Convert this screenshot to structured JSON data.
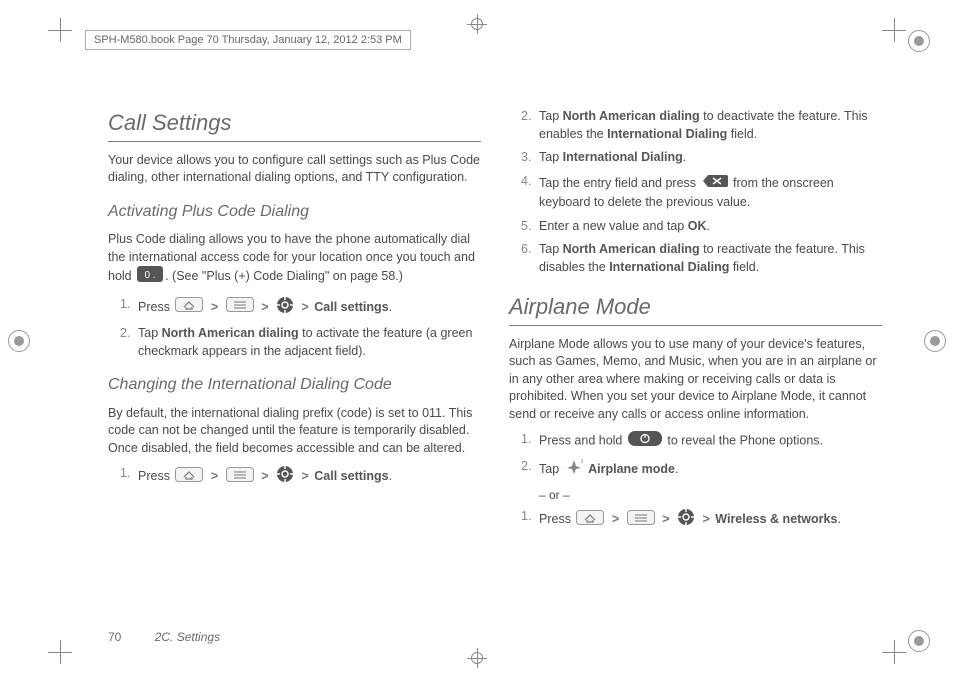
{
  "header": "SPH-M580.book  Page 70  Thursday, January 12, 2012  2:53 PM",
  "footer": {
    "page": "70",
    "section": "2C. Settings"
  },
  "left": {
    "h1": "Call Settings",
    "intro": "Your device allows you to configure call settings such as Plus Code dialing, other international dialing options, and TTY configuration.",
    "sec1": {
      "title": "Activating Plus Code Dialing",
      "body1": "Plus Code dialing allows you to have the phone automatically dial the international access code for your location once you touch and hold ",
      "body2": ". (See \"Plus (+) Code Dialing\" on page 58.)",
      "step1_a": "Press ",
      "step1_end": "Call settings",
      "step2_a": "Tap ",
      "step2_bold": "North American dialing",
      "step2_b": " to activate the feature (a green checkmark appears in the adjacent field)."
    },
    "sec2": {
      "title": "Changing the International Dialing Code",
      "body": "By default, the international dialing prefix (code) is set to 011. This code can not be changed until the feature is temporarily disabled. Once disabled, the field becomes accessible and can be altered.",
      "step1_a": "Press ",
      "step1_end": "Call settings"
    }
  },
  "right": {
    "step2_a": "Tap ",
    "step2_bold": "North American dialing",
    "step2_b": " to deactivate the feature. This enables the ",
    "step2_bold2": "International Dialing",
    "step2_c": " field.",
    "step3_a": "Tap ",
    "step3_bold": "International Dialing",
    "step4_a": "Tap the entry field and press ",
    "step4_b": " from the onscreen keyboard to delete the previous value.",
    "step5": "Enter a new value and tap ",
    "step5_bold": "OK",
    "step6_a": "Tap ",
    "step6_bold": "North American dialing",
    "step6_b": " to reactivate the feature. This disables the ",
    "step6_bold2": "International Dialing",
    "step6_c": " field.",
    "h1b": "Airplane Mode",
    "intro2": "Airplane Mode allows you to use many of your device's features, such as Games, Memo, and Music, when you are in an airplane or in any other area where making or receiving calls or data is prohibited. When you set your device to Airplane Mode, it cannot send or receive any calls or access online information.",
    "b_step1_a": "Press and hold ",
    "b_step1_b": " to reveal the Phone options.",
    "b_step2_a": "Tap ",
    "b_step2_bold": "Airplane mode",
    "or": "– or –",
    "b_step1b_a": "Press ",
    "b_step1b_end": "Wireless & networks"
  }
}
